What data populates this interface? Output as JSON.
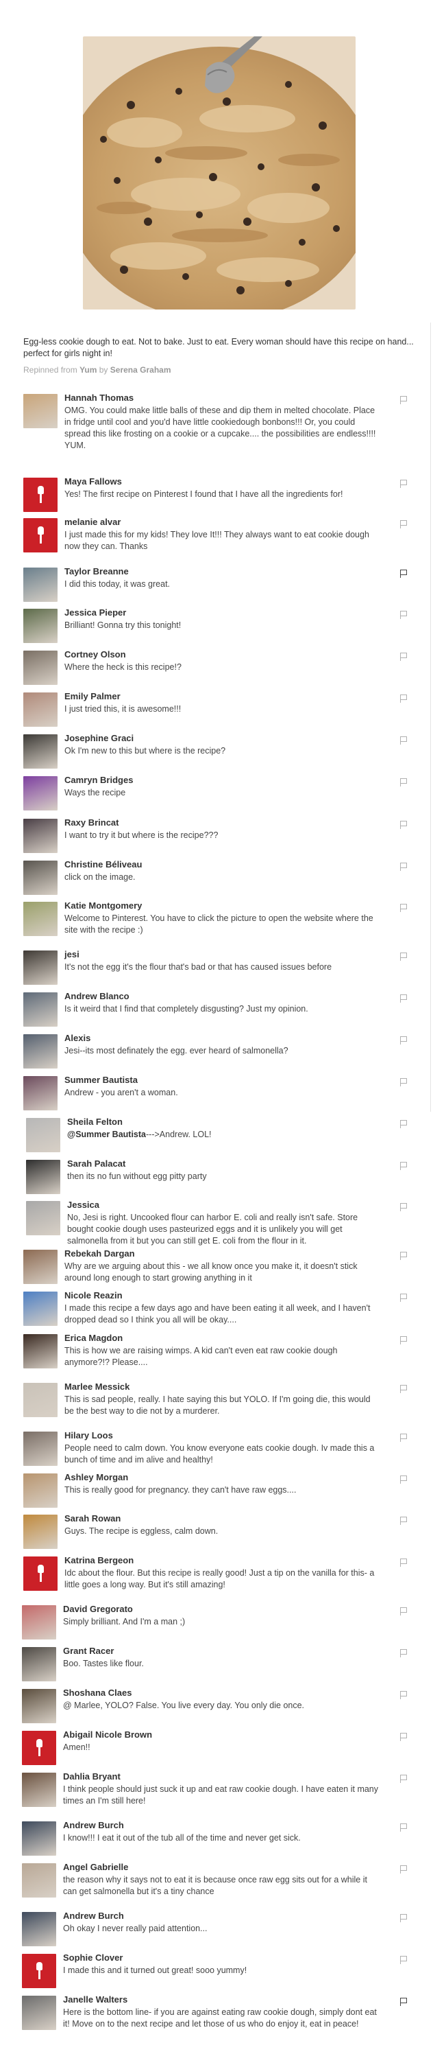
{
  "pin": {
    "image_alt": "Egg-less cookie dough in a bowl with a fork",
    "description": "Egg-less cookie dough to eat. Not to bake. Just to eat. Every woman should have this recipe on hand... perfect for girls night in!",
    "repin_prefix": "Repinned from",
    "repin_board": "Yum",
    "repin_by": "by",
    "repin_user": "Serena Graham"
  },
  "comments": [
    {
      "name": "Hannah Thomas",
      "text": "OMG. You could make little balls of these and dip them in melted chocolate. Place in fridge until cool and you'd have little cookiedough bonbons!!! Or, you could spread this like frosting on a cookie or a cupcake.... the possibilities are endless!!!! YUM.",
      "avatar": "photo",
      "avatar_color": "#c9a57a"
    },
    {
      "name": "Maya Fallows",
      "text": "Yes! The first recipe on Pinterest I found that I have all the ingredients for!",
      "avatar": "placeholder"
    },
    {
      "name": "melanie alvar",
      "text": "I just made this for my kids! They love It!!! They always want to eat cookie dough now they can. Thanks",
      "avatar": "placeholder"
    },
    {
      "name": "Taylor Breanne",
      "text": "I did this today, it was great.",
      "avatar": "photo",
      "avatar_color": "#6a7f8c"
    },
    {
      "name": "Jessica Pieper",
      "text": "Brilliant! Gonna try this tonight!",
      "avatar": "photo",
      "avatar_color": "#5d6b4a"
    },
    {
      "name": "Cortney Olson",
      "text": "Where the heck is this recipe!?",
      "avatar": "photo",
      "avatar_color": "#7a6f64"
    },
    {
      "name": "Emily Palmer",
      "text": "I just tried this, it is awesome!!!",
      "avatar": "photo",
      "avatar_color": "#b08a7a"
    },
    {
      "name": "Josephine Graci",
      "text": "Ok I'm new to this but where is the recipe?",
      "avatar": "photo",
      "avatar_color": "#3c3a36"
    },
    {
      "name": "Camryn Bridges",
      "text": "Ways the recipe",
      "avatar": "photo",
      "avatar_color": "#7d3fa0"
    },
    {
      "name": "Raxy Brincat",
      "text": "I want to try it but where is the recipe???",
      "avatar": "photo",
      "avatar_color": "#4a3f46"
    },
    {
      "name": "Christine Béliveau",
      "text": "click on the image.",
      "avatar": "photo",
      "avatar_color": "#59554f"
    },
    {
      "name": "Katie Montgomery",
      "text": "Welcome to Pinterest. You have to click the picture to open the website where the site with the recipe :)",
      "avatar": "photo",
      "avatar_color": "#9aa06a"
    },
    {
      "name": "jesi",
      "text": "It's not the egg it's the flour that's bad or that has caused issues before",
      "avatar": "photo",
      "avatar_color": "#3f3a35"
    },
    {
      "name": "Andrew Blanco",
      "text": "Is it weird that I find that completely disgusting? Just my opinion.",
      "avatar": "photo",
      "avatar_color": "#5e6a78"
    },
    {
      "name": "Alexis",
      "text": "Jesi--its most definately the egg. ever heard of salmonella?",
      "avatar": "photo",
      "avatar_color": "#55606f"
    },
    {
      "name": "Summer Bautista",
      "text": "Andrew - you aren't a woman.",
      "avatar": "photo",
      "avatar_color": "#6c4b5d"
    },
    {
      "name": "Sheila Felton",
      "mention": "@Summer Bautista",
      "text": "--->Andrew. LOL!",
      "avatar": "photo",
      "avatar_color": "#b7b7b7"
    },
    {
      "name": "Sarah Palacat",
      "text": "then its no fun without egg pitty party",
      "avatar": "photo",
      "avatar_color": "#2e2e2e"
    },
    {
      "name": "Jessica",
      "text": "No, Jesi is right. Uncooked flour can harbor E. coli and really isn't safe. Store bought cookie dough uses pasteurized eggs and it is unlikely you will get salmonella from it but you can still get E. coli from the flour in it.",
      "avatar": "photo",
      "avatar_color": "#a8a8a8"
    },
    {
      "name": "Rebekah Dargan",
      "text": "Why are we arguing about this - we all know once you make it, it doesn't stick around long enough to start growing anything in it",
      "avatar": "photo",
      "avatar_color": "#8c6a52"
    },
    {
      "name": "Nicole Reazin",
      "text": "I made this recipe a few days ago and have been eating it all week, and I haven't dropped dead so I think you all will be okay....",
      "avatar": "photo",
      "avatar_color": "#4d7fc4"
    },
    {
      "name": "Erica Magdon",
      "text": "This is how we are raising wimps. A kid can't even eat raw cookie dough anymore?!? Please....",
      "avatar": "photo",
      "avatar_color": "#3a2a22"
    },
    {
      "name": "Marlee Messick",
      "text": "This is sad people, really. I hate saying this but YOLO. If I'm going die, this would be the best way to die not by a murderer.",
      "avatar": "photo",
      "avatar_color": "#c9c2b8"
    },
    {
      "name": "Hilary Loos",
      "text": "People need to calm down. You know everyone eats cookie dough. Iv made this a bunch of time and im alive and healthy!",
      "avatar": "photo",
      "avatar_color": "#7a6e66"
    },
    {
      "name": "Ashley Morgan",
      "text": "This is really good for pregnancy. they can't have raw eggs....",
      "avatar": "photo",
      "avatar_color": "#b8956f"
    },
    {
      "name": "Sarah Rowan",
      "text": "Guys. The recipe is eggless, calm down.",
      "avatar": "photo",
      "avatar_color": "#c08a3e"
    },
    {
      "name": "Katrina Bergeon",
      "text": "Idc about the flour. But this recipe is really good! Just a tip on the vanilla for this- a little goes a long way. But it's still amazing!",
      "avatar": "placeholder"
    },
    {
      "name": "David Gregorato",
      "text": "Simply brilliant. And I'm a man ;)",
      "avatar": "photo",
      "avatar_color": "#c46a6a"
    },
    {
      "name": "Grant Racer",
      "text": "Boo. Tastes like flour.",
      "avatar": "photo",
      "avatar_color": "#4e4a45"
    },
    {
      "name": "Shoshana Claes",
      "text": "@ Marlee, YOLO? False. You live every day. You only die once.",
      "avatar": "photo",
      "avatar_color": "#5b4e3e"
    },
    {
      "name": "Abigail Nicole Brown",
      "text": "Amen!!",
      "avatar": "placeholder"
    },
    {
      "name": "Dahlia Bryant",
      "text": "I think people should just suck it up and eat raw cookie dough. I have eaten it many times an I'm still here!",
      "avatar": "photo",
      "avatar_color": "#6b5240"
    },
    {
      "name": "Andrew Burch",
      "text": "I know!!! I eat it out of the tub all of the time and never get sick.",
      "avatar": "photo",
      "avatar_color": "#3e4a5c"
    },
    {
      "name": "Angel Gabrielle",
      "text": "the reason why it says not to eat it is because once raw egg sits out for a while it can get salmonella but it's a tiny chance",
      "avatar": "photo",
      "avatar_color": "#b9a896"
    },
    {
      "name": "Andrew Burch",
      "text": "Oh okay I never really paid attention...",
      "avatar": "photo",
      "avatar_color": "#3e4a5c"
    },
    {
      "name": "Sophie Clover",
      "text": "I made this and it turned out great! sooo yummy!",
      "avatar": "placeholder"
    },
    {
      "name": "Janelle Walters",
      "text": "Here is the bottom line- if you are against eating raw cookie dough, simply dont eat it! Move on to the next recipe and let those of us who do enjoy it, eat in peace!",
      "avatar": "photo",
      "avatar_color": "#6c6c6c"
    }
  ]
}
